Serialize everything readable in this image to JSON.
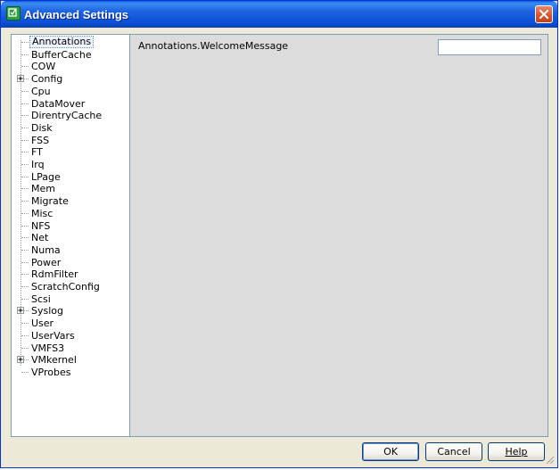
{
  "window": {
    "title": "Advanced Settings"
  },
  "tree": {
    "items": [
      {
        "label": "Annotations",
        "expandable": false,
        "selected": true
      },
      {
        "label": "BufferCache",
        "expandable": false,
        "selected": false
      },
      {
        "label": "COW",
        "expandable": false,
        "selected": false
      },
      {
        "label": "Config",
        "expandable": true,
        "selected": false
      },
      {
        "label": "Cpu",
        "expandable": false,
        "selected": false
      },
      {
        "label": "DataMover",
        "expandable": false,
        "selected": false
      },
      {
        "label": "DirentryCache",
        "expandable": false,
        "selected": false
      },
      {
        "label": "Disk",
        "expandable": false,
        "selected": false
      },
      {
        "label": "FSS",
        "expandable": false,
        "selected": false
      },
      {
        "label": "FT",
        "expandable": false,
        "selected": false
      },
      {
        "label": "Irq",
        "expandable": false,
        "selected": false
      },
      {
        "label": "LPage",
        "expandable": false,
        "selected": false
      },
      {
        "label": "Mem",
        "expandable": false,
        "selected": false
      },
      {
        "label": "Migrate",
        "expandable": false,
        "selected": false
      },
      {
        "label": "Misc",
        "expandable": false,
        "selected": false
      },
      {
        "label": "NFS",
        "expandable": false,
        "selected": false
      },
      {
        "label": "Net",
        "expandable": false,
        "selected": false
      },
      {
        "label": "Numa",
        "expandable": false,
        "selected": false
      },
      {
        "label": "Power",
        "expandable": false,
        "selected": false
      },
      {
        "label": "RdmFilter",
        "expandable": false,
        "selected": false
      },
      {
        "label": "ScratchConfig",
        "expandable": false,
        "selected": false
      },
      {
        "label": "Scsi",
        "expandable": false,
        "selected": false
      },
      {
        "label": "Syslog",
        "expandable": true,
        "selected": false
      },
      {
        "label": "User",
        "expandable": false,
        "selected": false
      },
      {
        "label": "UserVars",
        "expandable": false,
        "selected": false
      },
      {
        "label": "VMFS3",
        "expandable": false,
        "selected": false
      },
      {
        "label": "VMkernel",
        "expandable": true,
        "selected": false
      },
      {
        "label": "VProbes",
        "expandable": false,
        "selected": false
      }
    ]
  },
  "panel": {
    "setting_label": "Annotations.WelcomeMessage",
    "setting_value": ""
  },
  "buttons": {
    "ok": "OK",
    "cancel": "Cancel",
    "help": "Help"
  },
  "colors": {
    "titlebar": "#0b50d8",
    "close": "#d9542c",
    "panel_bg": "#dcdcdc",
    "dialog_bg": "#ece9d8"
  }
}
